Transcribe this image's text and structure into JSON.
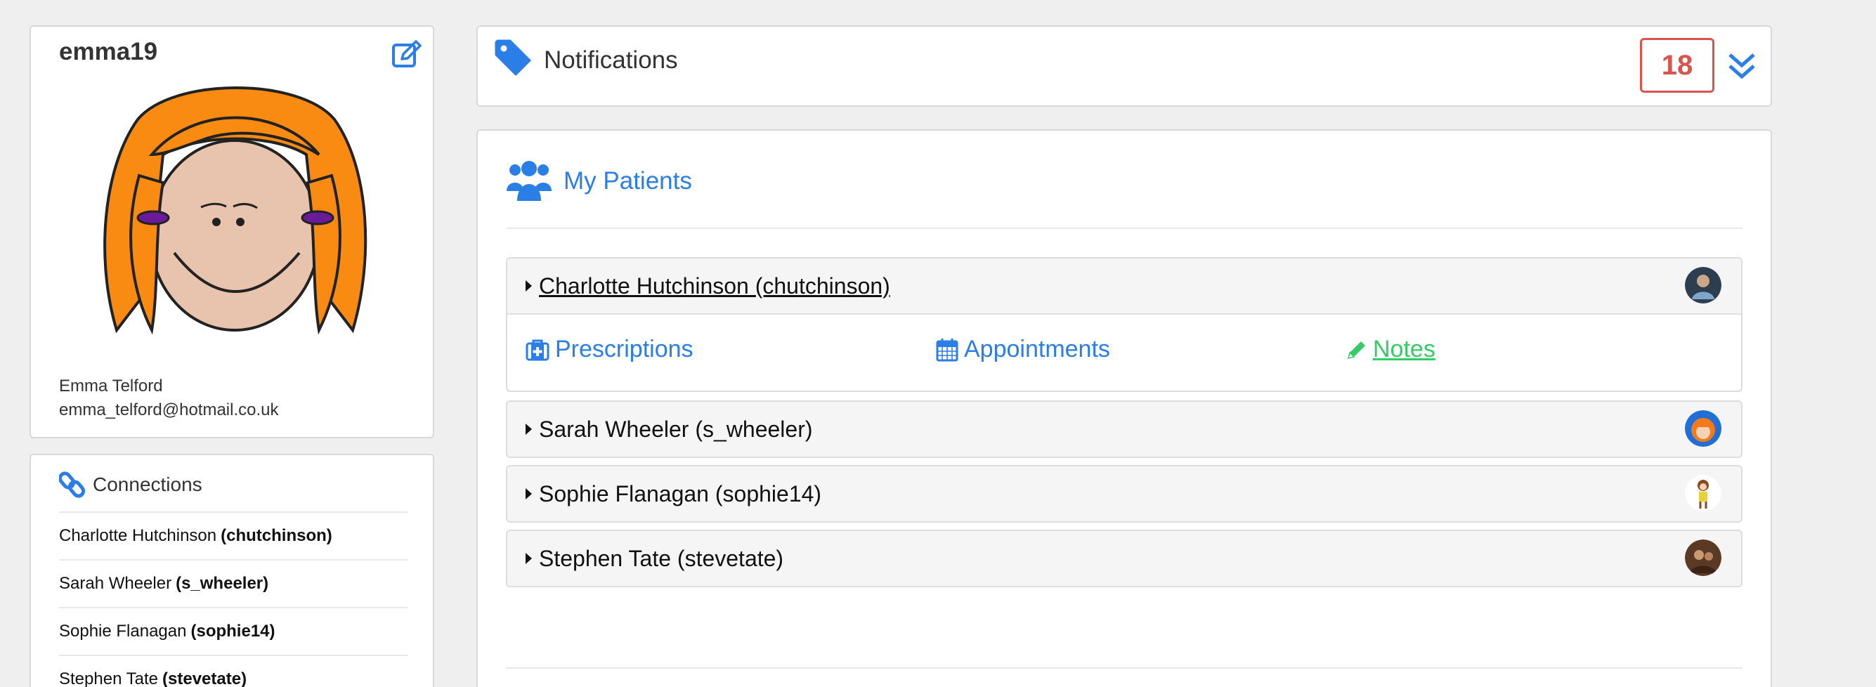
{
  "profile": {
    "username": "emma19",
    "full_name": "Emma Telford",
    "email": "emma_telford@hotmail.co.uk"
  },
  "connections": {
    "title": "Connections",
    "items": [
      {
        "name": "Charlotte Hutchinson",
        "handle": "(chutchinson)"
      },
      {
        "name": "Sarah Wheeler",
        "handle": "(s_wheeler)"
      },
      {
        "name": "Sophie Flanagan",
        "handle": "(sophie14)"
      },
      {
        "name": "Stephen Tate",
        "handle": "(stevetate)"
      }
    ]
  },
  "notifications": {
    "title": "Notifications",
    "count": "18"
  },
  "patients": {
    "title": "My Patients",
    "items": [
      {
        "label": "Charlotte Hutchinson (chutchinson)"
      },
      {
        "label": "Sarah Wheeler (s_wheeler)"
      },
      {
        "label": "Sophie Flanagan (sophie14)"
      },
      {
        "label": "Stephen Tate (stevetate)"
      }
    ],
    "links": {
      "prescriptions": "Prescriptions",
      "appointments": "Appointments",
      "notes": " Notes"
    }
  },
  "colors": {
    "primary": "#2a7ee6",
    "badge": "#d9534f",
    "notes": "#33cc66"
  }
}
